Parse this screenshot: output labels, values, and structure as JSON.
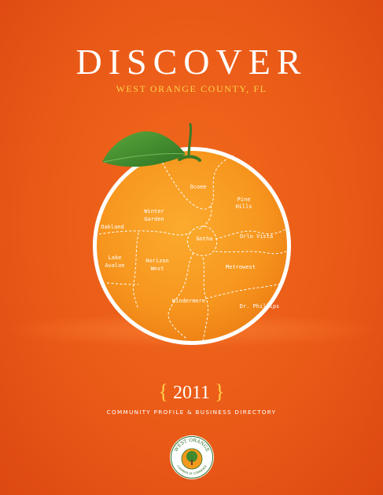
{
  "cover": {
    "title": "DISCOVER",
    "subtitle": "WEST ORANGE COUNTY, FL",
    "year": "2011",
    "brace_left": "{",
    "brace_right": "}",
    "tagline": "COMMUNITY PROFILE & BUSINESS DIRECTORY"
  },
  "map": {
    "labels": {
      "ocoee": "Ocoee",
      "pine_hills_1": "Pine",
      "pine_hills_2": "Hills",
      "winter_garden_1": "Winter",
      "winter_garden_2": "Garden",
      "oakland": "Oakland",
      "gotha": "Gotha",
      "orlo_vista": "Orlo Vista",
      "lake_avalon_1": "Lake",
      "lake_avalon_2": "Avalon",
      "horizon_west_1": "Horizon",
      "horizon_west_2": "West",
      "metrowest": "Metrowest",
      "windermere": "Windermere",
      "dr_phillips": "Dr. Phillips"
    }
  },
  "seal": {
    "text_top": "WEST ORANGE",
    "text_bottom": "CHAMBER OF COMMERCE"
  },
  "colors": {
    "background": "#ea5a17",
    "orange_fill": "#f7961e",
    "accent_yellow": "#ffd24a",
    "leaf_green": "#3f8a2e"
  }
}
